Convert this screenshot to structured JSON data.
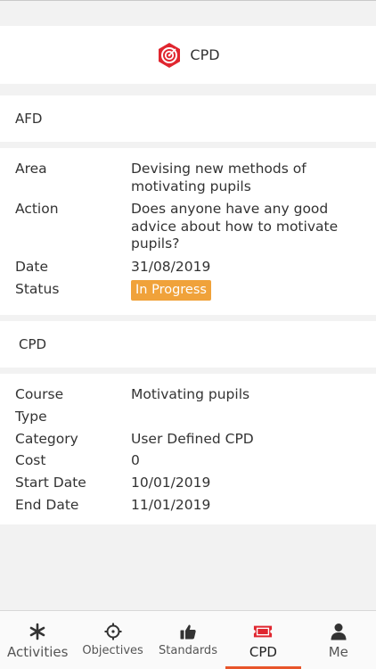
{
  "header": {
    "title": "CPD"
  },
  "afd": {
    "section_title": "AFD",
    "fields": [
      {
        "label": "Area",
        "value": "Devising new methods of motivating pupils"
      },
      {
        "label": "Action",
        "value": "Does anyone have any good advice about how to motivate pupils?"
      },
      {
        "label": "Date",
        "value": "31/08/2019"
      },
      {
        "label": "Status",
        "value": "In Progress"
      }
    ]
  },
  "cpd": {
    "section_title": "CPD",
    "fields": [
      {
        "label": "Course",
        "value": "Motivating pupils"
      },
      {
        "label": "Type",
        "value": ""
      },
      {
        "label": "Category",
        "value": "User Defined CPD"
      },
      {
        "label": "Cost",
        "value": "0"
      },
      {
        "label": "Start Date",
        "value": "10/01/2019"
      },
      {
        "label": "End Date",
        "value": "11/01/2019"
      }
    ]
  },
  "tabs": [
    {
      "label": "Activities",
      "icon": "asterisk-icon"
    },
    {
      "label": "Objectives",
      "icon": "crosshair-icon"
    },
    {
      "label": "Standards",
      "icon": "thumbs-up-icon"
    },
    {
      "label": "CPD",
      "icon": "ticket-icon",
      "active": true
    },
    {
      "label": "Me",
      "icon": "person-icon"
    }
  ],
  "colors": {
    "accent": "#e8552a",
    "status_badge": "#f0a23a",
    "logo": "#e0262f"
  }
}
